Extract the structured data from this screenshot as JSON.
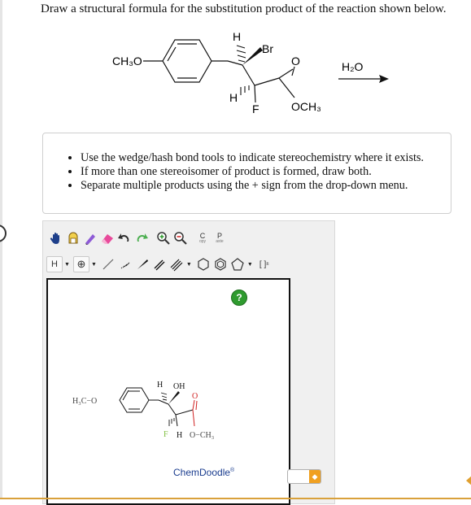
{
  "question": {
    "prompt": "Draw a structural formula for the substitution product of the reaction shown below."
  },
  "reaction": {
    "reactant_labels": {
      "methoxy": "CH₃O",
      "h_top": "H",
      "br": "Br",
      "o_carbonyl": "O",
      "h_bottom": "H",
      "f": "F",
      "och3": "OCH₃"
    },
    "reagent": "H₂O"
  },
  "instructions": {
    "items": [
      "Use the wedge/hash bond tools to indicate stereochemistry where it exists.",
      "If more than one stereoisomer of product is formed, draw both.",
      "Separate multiple products using the + sign from the drop-down menu."
    ]
  },
  "editor": {
    "toolbar1": {
      "copy_top": "C",
      "copy_bottom": "opy",
      "paste_top": "P",
      "paste_bottom": "aste"
    },
    "toolbar2": {
      "element": "H",
      "charge": "⊕",
      "bracket": "[ ]",
      "bracket_sup": "±"
    },
    "help_label": "?",
    "brand": "ChemDoodle",
    "brand_mark": "®",
    "molecule_labels": {
      "h3c_o": "H₃C−O",
      "h": "H",
      "oh": "OH",
      "o_carbonyl": "O",
      "f": "F",
      "h_bottom": "H",
      "o_ch3": "O−CH₃"
    }
  },
  "colors": {
    "accent_green": "#2f9b2f",
    "brand_blue": "#1b3d8f",
    "scroll_orange": "#f0a020",
    "fluorine_green": "#7fbf3f",
    "oxygen_red": "#d02020"
  }
}
